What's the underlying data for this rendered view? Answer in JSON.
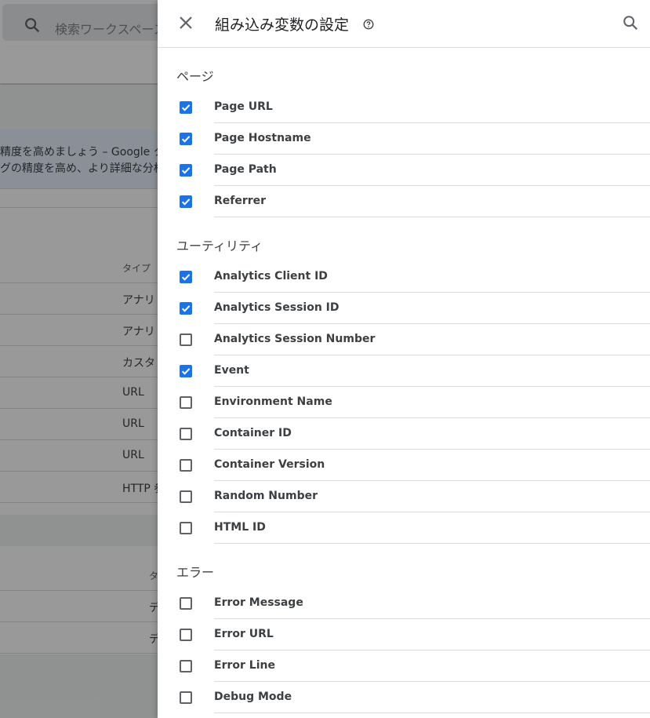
{
  "background": {
    "search_placeholder": "検索ワークスペース",
    "banner_lines": [
      "精度を高めましょう – Google タ",
      "グの精度を高め、より詳細な分析"
    ],
    "table1": {
      "type_header": "タイプ",
      "types": [
        "アナリ",
        "アナリ",
        "カスタ",
        "URL",
        "URL",
        "URL",
        "HTTP 参"
      ]
    },
    "table2": {
      "type_header": "タ",
      "types": [
        "デ",
        "デ"
      ]
    }
  },
  "panel": {
    "title": "組み込み変数の設定",
    "help_icon": "help-circle-icon",
    "close_icon": "close-icon",
    "search_icon": "search-icon",
    "checkbox_color": "#1a73e8",
    "sections": [
      {
        "title": "ページ",
        "items": [
          {
            "label": "Page URL",
            "checked": true
          },
          {
            "label": "Page Hostname",
            "checked": true
          },
          {
            "label": "Page Path",
            "checked": true
          },
          {
            "label": "Referrer",
            "checked": true
          }
        ]
      },
      {
        "title": "ユーティリティ",
        "items": [
          {
            "label": "Analytics Client ID",
            "checked": true
          },
          {
            "label": "Analytics Session ID",
            "checked": true
          },
          {
            "label": "Analytics Session Number",
            "checked": false
          },
          {
            "label": "Event",
            "checked": true
          },
          {
            "label": "Environment Name",
            "checked": false
          },
          {
            "label": "Container ID",
            "checked": false
          },
          {
            "label": "Container Version",
            "checked": false
          },
          {
            "label": "Random Number",
            "checked": false
          },
          {
            "label": "HTML ID",
            "checked": false
          }
        ]
      },
      {
        "title": "エラー",
        "items": [
          {
            "label": "Error Message",
            "checked": false
          },
          {
            "label": "Error URL",
            "checked": false
          },
          {
            "label": "Error Line",
            "checked": false
          },
          {
            "label": "Debug Mode",
            "checked": false
          }
        ]
      }
    ]
  }
}
